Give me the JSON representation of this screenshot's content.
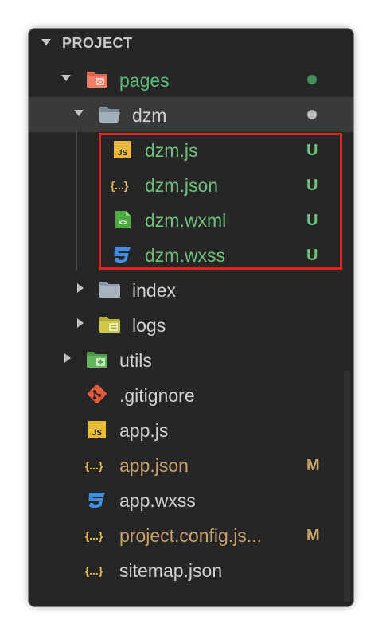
{
  "explorer": {
    "section_title": "PROJECT",
    "items": [
      {
        "label": "pages",
        "status": "",
        "dot": "#3f8d5a"
      },
      {
        "label": "dzm",
        "status": "",
        "dot": "#b8b8b8"
      },
      {
        "label": "dzm.js",
        "status": "U",
        "icon_text": "JS"
      },
      {
        "label": "dzm.json",
        "status": "U",
        "icon_text": "{...}"
      },
      {
        "label": "dzm.wxml",
        "status": "U",
        "icon_text": "<>"
      },
      {
        "label": "dzm.wxss",
        "status": "U"
      },
      {
        "label": "index",
        "status": ""
      },
      {
        "label": "logs",
        "status": ""
      },
      {
        "label": "utils",
        "status": ""
      },
      {
        "label": ".gitignore",
        "status": ""
      },
      {
        "label": "app.js",
        "status": "",
        "icon_text": "JS"
      },
      {
        "label": "app.json",
        "status": "M",
        "icon_text": "{...}"
      },
      {
        "label": "app.wxss",
        "status": ""
      },
      {
        "label": "project.config.js...",
        "status": "M",
        "icon_text": "{...}"
      },
      {
        "label": "sitemap.json",
        "status": "",
        "icon_text": "{...}"
      }
    ]
  },
  "colors": {
    "panel_bg": "#262626",
    "selected_row": "#3a3a3a",
    "highlight_border": "#e4231d",
    "untracked": "#6fbf7e",
    "modified": "#c7a16a",
    "json_yellow": "#e5bc52",
    "css_blue": "#3f8ee8",
    "folder_gray": "#8f9aa6"
  }
}
